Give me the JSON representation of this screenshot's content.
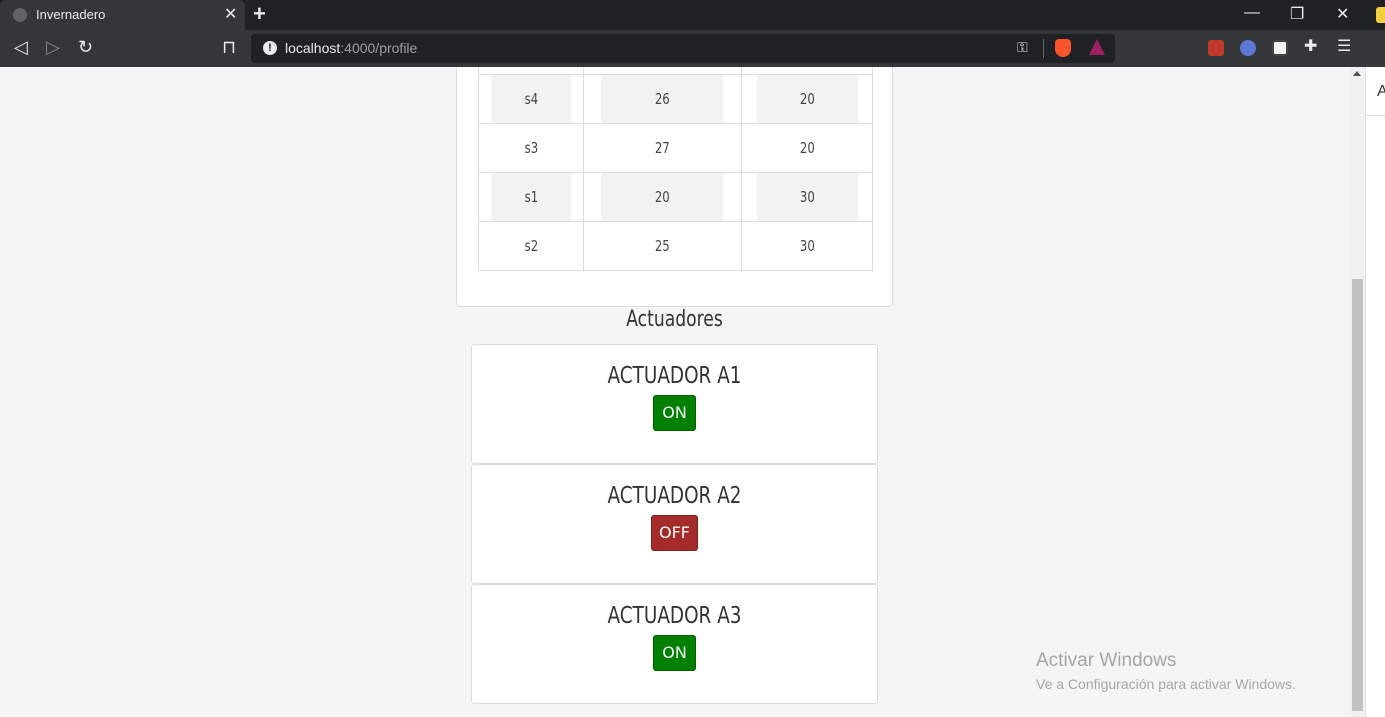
{
  "browser": {
    "tab_title": "Invernadero",
    "url_host": "localhost",
    "url_path": ":4000/profile"
  },
  "sensor_table": {
    "rows": [
      {
        "id": "s4",
        "v1": "26",
        "v2": "20"
      },
      {
        "id": "s3",
        "v1": "27",
        "v2": "20"
      },
      {
        "id": "s1",
        "v1": "20",
        "v2": "30"
      },
      {
        "id": "s2",
        "v1": "25",
        "v2": "30"
      }
    ]
  },
  "actuators": {
    "title": "Actuadores",
    "items": [
      {
        "name": "ACTUADOR A1",
        "state": "ON"
      },
      {
        "name": "ACTUADOR A2",
        "state": "OFF"
      },
      {
        "name": "ACTUADOR A3",
        "state": "ON"
      }
    ]
  },
  "watermark": {
    "line1": "Activar Windows",
    "line2": "Ve a Configuración para activar Windows."
  },
  "side_panel": {
    "letter": "A"
  },
  "colors": {
    "on": "#008000",
    "off": "#a52a2a"
  }
}
